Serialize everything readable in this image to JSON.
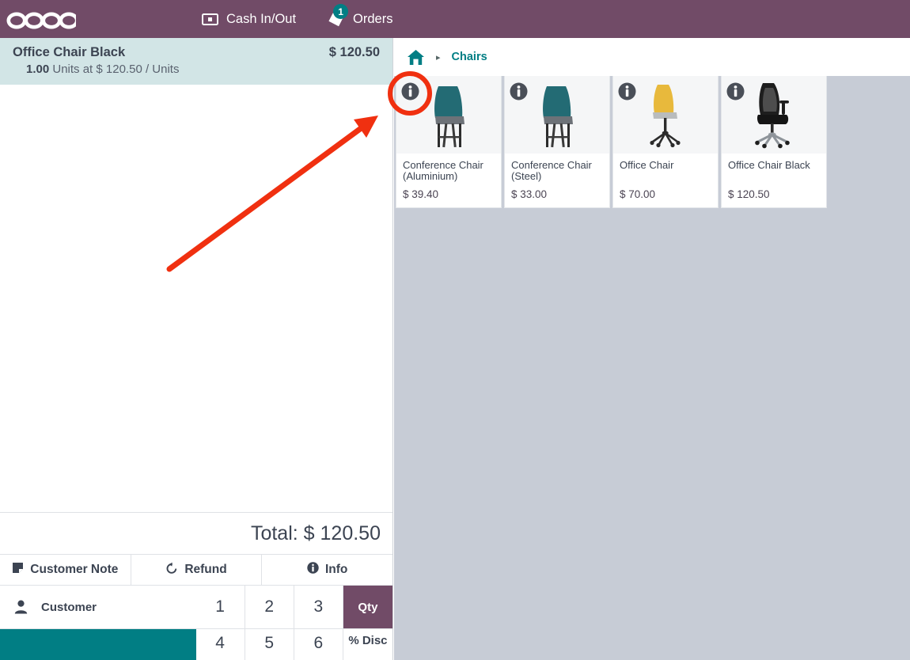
{
  "app": {
    "brand": "odoo",
    "accent_purple": "#714b67",
    "accent_teal": "#017e84",
    "annotation_color": "#f03010"
  },
  "topbar": {
    "cash_in_out_label": "Cash In/Out",
    "cash_in_out_icon": "banknote-icon",
    "orders_label": "Orders",
    "orders_icon": "order-tag-icon",
    "orders_badge": "1"
  },
  "cart": {
    "lines": [
      {
        "name": "Office Chair Black",
        "price": "$ 120.50",
        "qty": "1.00",
        "detail": "Units at $ 120.50 / Units"
      }
    ],
    "total_label": "Total:",
    "total_value": "$ 120.50",
    "actions": [
      {
        "label": "Customer Note",
        "icon": "note-icon"
      },
      {
        "label": "Refund",
        "icon": "refund-icon"
      },
      {
        "label": "Info",
        "icon": "info-icon"
      }
    ],
    "customer_button_label": "Customer",
    "customer_icon": "person-icon",
    "numpad": {
      "keys_row1": [
        "1",
        "2",
        "3"
      ],
      "keys_row2": [
        "4",
        "5",
        "6"
      ],
      "mode_row1": "Qty",
      "mode_row2": "% Disc",
      "active_mode": "Qty"
    }
  },
  "products": {
    "breadcrumb": {
      "home_icon": "home-icon",
      "separator": "▸",
      "current": "Chairs"
    },
    "items": [
      {
        "name": "Conference Chair (Aluminium)",
        "price": "$ 39.40",
        "image": "teal-shell-chair-aluminium-legs",
        "info_icon": "info-icon"
      },
      {
        "name": "Conference Chair (Steel)",
        "price": "$ 33.00",
        "image": "teal-shell-chair-steel-legs",
        "info_icon": "info-icon"
      },
      {
        "name": "Office Chair",
        "price": "$ 70.00",
        "image": "yellow-swivel-office-chair",
        "info_icon": "info-icon"
      },
      {
        "name": "Office Chair Black",
        "price": "$ 120.50",
        "image": "black-mesh-executive-chair",
        "info_icon": "info-icon"
      }
    ]
  },
  "annotations": {
    "highlight_circle_target": "info-icon-on-first-product",
    "arrow": "points-to-first-product-info-icon"
  }
}
